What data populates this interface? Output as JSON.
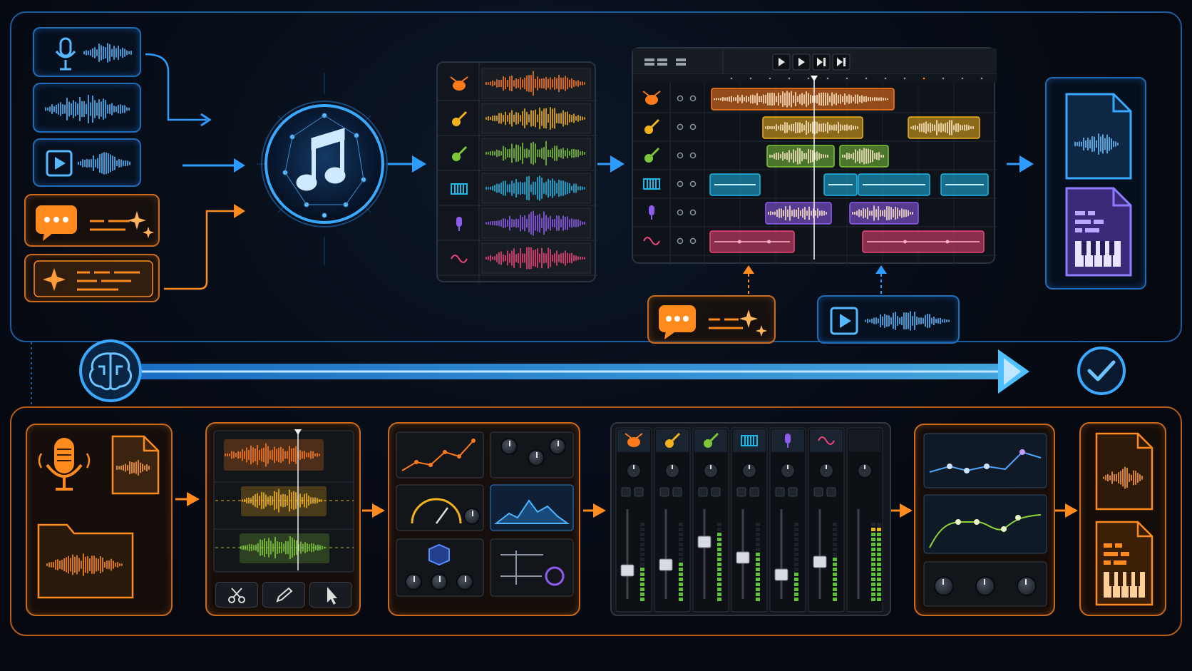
{
  "colors": {
    "blue": "#2e9bff",
    "blue_glow": "#56b8ff",
    "orange": "#ff8a1e",
    "drums": "#ff7a1a",
    "guitar1": "#f2b21b",
    "guitar2": "#7ec73a",
    "keys": "#1fb6e8",
    "vocal": "#8f5cf0",
    "synth": "#f0457a",
    "panel_bg": "#11161e"
  },
  "tracks": [
    {
      "name": "drums",
      "icon": "drum-icon"
    },
    {
      "name": "guitar",
      "icon": "guitar-icon"
    },
    {
      "name": "guitar",
      "icon": "guitar-icon"
    },
    {
      "name": "keys",
      "icon": "piano-keys-icon"
    },
    {
      "name": "vocal",
      "icon": "microphone-icon"
    },
    {
      "name": "synth",
      "icon": "sine-wave-icon"
    }
  ],
  "icons": {
    "mic": "microphone-icon",
    "wave": "waveform-icon",
    "video": "play-icon",
    "prompt": "chat-bubble-icon",
    "spark": "sparkle-icon",
    "ai_core": "music-note-icon",
    "brain": "brain-icon",
    "check": "check-icon",
    "audio_file": "audio-file-icon",
    "midi_file": "midi-file-icon",
    "folder": "folder-icon",
    "scissors": "scissors-icon",
    "pencil": "pencil-icon",
    "cursor": "cursor-icon"
  },
  "transport": {
    "buttons": [
      "play",
      "play",
      "skip",
      "skip"
    ]
  }
}
